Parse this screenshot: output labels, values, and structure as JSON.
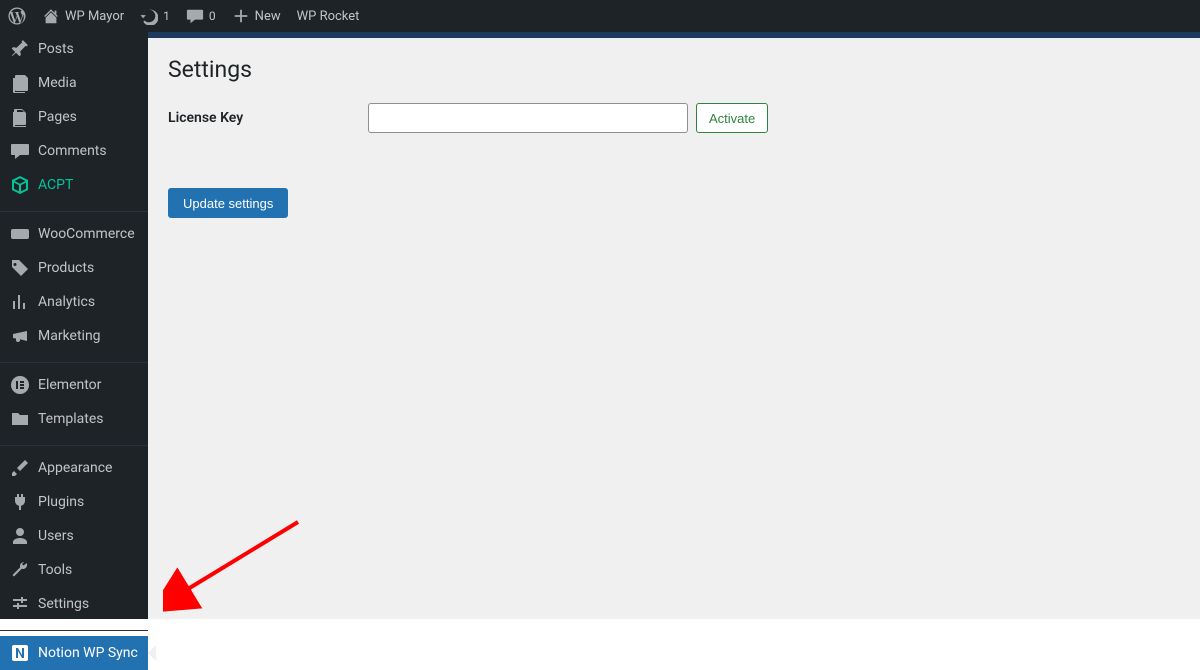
{
  "adminbar": {
    "site_name": "WP Mayor",
    "updates_count": "1",
    "comments_count": "0",
    "new_label": "New",
    "wp_rocket_label": "WP Rocket"
  },
  "sidebar": {
    "items": [
      {
        "key": "posts",
        "label": "Posts"
      },
      {
        "key": "media",
        "label": "Media"
      },
      {
        "key": "pages",
        "label": "Pages"
      },
      {
        "key": "comments",
        "label": "Comments"
      },
      {
        "key": "acpt",
        "label": "ACPT"
      },
      {
        "key": "woocommerce",
        "label": "WooCommerce"
      },
      {
        "key": "products",
        "label": "Products"
      },
      {
        "key": "analytics",
        "label": "Analytics"
      },
      {
        "key": "marketing",
        "label": "Marketing"
      },
      {
        "key": "elementor",
        "label": "Elementor"
      },
      {
        "key": "templates",
        "label": "Templates"
      },
      {
        "key": "appearance",
        "label": "Appearance"
      },
      {
        "key": "plugins",
        "label": "Plugins"
      },
      {
        "key": "users",
        "label": "Users"
      },
      {
        "key": "tools",
        "label": "Tools"
      },
      {
        "key": "settings",
        "label": "Settings"
      },
      {
        "key": "notion-wp-sync",
        "label": "Notion WP Sync"
      }
    ]
  },
  "page": {
    "title": "Settings",
    "license_label": "License Key",
    "license_value": "",
    "activate_label": "Activate",
    "update_label": "Update settings"
  }
}
